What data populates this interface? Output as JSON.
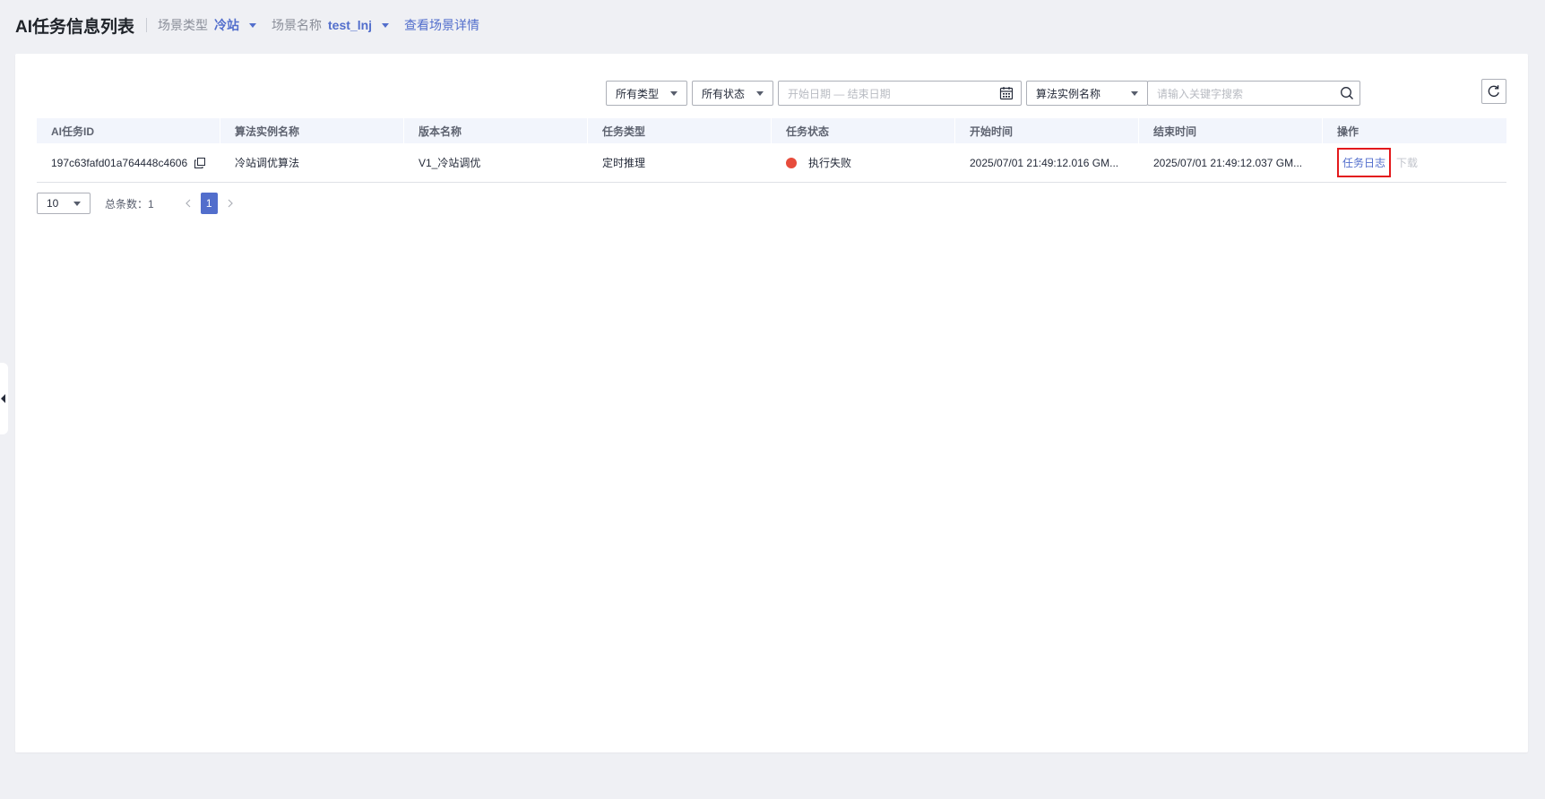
{
  "header": {
    "title": "AI任务信息列表",
    "scene_type_label": "场景类型",
    "scene_type_value": "冷站",
    "scene_name_label": "场景名称",
    "scene_name_value": "test_lnj",
    "detail_link": "查看场景详情"
  },
  "toolbar": {
    "type_filter": "所有类型",
    "status_filter": "所有状态",
    "date_range_placeholder": "开始日期 — 结束日期",
    "search_field": "算法实例名称",
    "search_placeholder": "请输入关键字搜索"
  },
  "table": {
    "columns": [
      "AI任务ID",
      "算法实例名称",
      "版本名称",
      "任务类型",
      "任务状态",
      "开始时间",
      "结束时间",
      "操作"
    ],
    "rows": [
      {
        "task_id": "197c63fafd01a764448c4606",
        "algorithm_instance": "冷站调优算法",
        "version": "V1_冷站调优",
        "task_type": "定时推理",
        "status": "执行失败",
        "status_color": "#e74c3c",
        "start_time": "2025/07/01 21:49:12.016 GM...",
        "end_time": "2025/07/01 21:49:12.037 GM...",
        "op_log": "任务日志",
        "op_download": "下载"
      }
    ]
  },
  "pagination": {
    "page_size": "10",
    "total": "总条数：1",
    "current_page": "1"
  },
  "colors": {
    "accent": "#526ecc",
    "error": "#e74c3c",
    "highlight_border": "#e3191c"
  }
}
